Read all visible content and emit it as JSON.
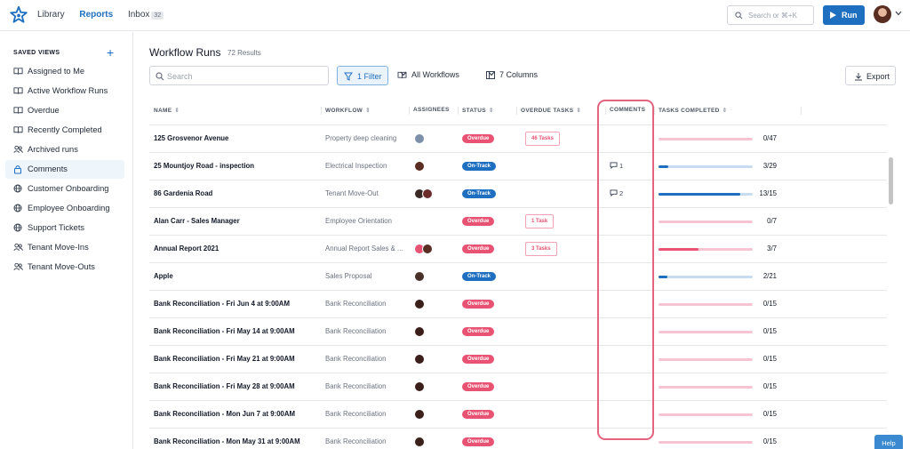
{
  "nav": {
    "library": "Library",
    "reports": "Reports",
    "inbox": "Inbox",
    "inbox_count": "32",
    "search_placeholder": "Search or ⌘+K",
    "run": "Run"
  },
  "sidebar": {
    "heading": "SAVED VIEWS",
    "items": [
      {
        "label": "Assigned to Me",
        "icon": "book-icon"
      },
      {
        "label": "Active Workflow Runs",
        "icon": "book-icon"
      },
      {
        "label": "Overdue",
        "icon": "book-icon"
      },
      {
        "label": "Recently Completed",
        "icon": "book-icon"
      },
      {
        "label": "Archived runs",
        "icon": "users-icon"
      },
      {
        "label": "Comments",
        "icon": "lock-icon"
      },
      {
        "label": "Customer Onboarding",
        "icon": "globe-icon"
      },
      {
        "label": "Employee Onboarding",
        "icon": "globe-icon"
      },
      {
        "label": "Support Tickets",
        "icon": "globe-icon"
      },
      {
        "label": "Tenant Move-Ins",
        "icon": "users-icon"
      },
      {
        "label": "Tenant Move-Outs",
        "icon": "users-icon"
      }
    ],
    "active_index": 5
  },
  "main": {
    "title": "Workflow Runs",
    "results": "72 Results",
    "search_placeholder": "Search",
    "filter": "1 Filter",
    "workflows": "All Workflows",
    "columns": "7 Columns",
    "export": "Export",
    "help": "Help"
  },
  "table": {
    "headers": [
      "NAME",
      "WORKFLOW",
      "ASSIGNEES",
      "STATUS",
      "OVERDUE TASKS",
      "COMMENTS",
      "TASKS COMPLETED"
    ],
    "rows": [
      {
        "name": "125 Grosvenor Avenue",
        "workflow": "Property deep cleaning",
        "assignees": [
          "#7b8fa6"
        ],
        "status": "Overdue",
        "overdue_tasks": "46 Tasks",
        "comments": "",
        "done": 0,
        "total": 47,
        "count": "0/47"
      },
      {
        "name": "25 Mountjoy Road - inspection",
        "workflow": "Electrical Inspection",
        "assignees": [
          "#5a2d22"
        ],
        "status": "On-Track",
        "overdue_tasks": "",
        "comments": "1",
        "done": 3,
        "total": 29,
        "count": "3/29"
      },
      {
        "name": "86 Gardenia Road",
        "workflow": "Tenant Move-Out",
        "assignees": [
          "#3a2a26",
          "#6b2b2b"
        ],
        "status": "On-Track",
        "overdue_tasks": "",
        "comments": "2",
        "done": 13,
        "total": 15,
        "count": "13/15"
      },
      {
        "name": "Alan Carr - Sales Manager",
        "workflow": "Employee Orientation",
        "assignees": [],
        "status": "Overdue",
        "overdue_tasks": "1 Task",
        "comments": "",
        "done": 0,
        "total": 7,
        "count": "0/7"
      },
      {
        "name": "Annual Report 2021",
        "workflow": "Annual Report Sales & ...",
        "assignees": [
          "#e95373",
          "#5a2d22"
        ],
        "status": "Overdue",
        "overdue_tasks": "3 Tasks",
        "comments": "",
        "done": 3,
        "total": 7,
        "count": "3/7"
      },
      {
        "name": "Apple",
        "workflow": "Sales Proposal",
        "assignees": [
          "#4a3028"
        ],
        "status": "On-Track",
        "overdue_tasks": "",
        "comments": "",
        "done": 2,
        "total": 21,
        "count": "2/21"
      },
      {
        "name": "Bank Reconciliation - Fri Jun 4 at 9:00AM",
        "workflow": "Bank Reconciliation",
        "assignees": [
          "#3b1f1a"
        ],
        "status": "Overdue",
        "overdue_tasks": "",
        "comments": "",
        "done": 0,
        "total": 15,
        "count": "0/15"
      },
      {
        "name": "Bank Reconciliation - Fri May 14 at 9:00AM",
        "workflow": "Bank Reconciliation",
        "assignees": [
          "#3b1f1a"
        ],
        "status": "Overdue",
        "overdue_tasks": "",
        "comments": "",
        "done": 0,
        "total": 15,
        "count": "0/15"
      },
      {
        "name": "Bank Reconciliation - Fri May 21 at 9:00AM",
        "workflow": "Bank Reconciliation",
        "assignees": [
          "#3b1f1a"
        ],
        "status": "Overdue",
        "overdue_tasks": "",
        "comments": "",
        "done": 0,
        "total": 15,
        "count": "0/15"
      },
      {
        "name": "Bank Reconciliation - Fri May 28 at 9:00AM",
        "workflow": "Bank Reconciliation",
        "assignees": [
          "#3b1f1a"
        ],
        "status": "Overdue",
        "overdue_tasks": "",
        "comments": "",
        "done": 0,
        "total": 15,
        "count": "0/15"
      },
      {
        "name": "Bank Reconciliation - Mon Jun 7 at 9:00AM",
        "workflow": "Bank Reconciliation",
        "assignees": [
          "#3b1f1a"
        ],
        "status": "Overdue",
        "overdue_tasks": "",
        "comments": "",
        "done": 0,
        "total": 15,
        "count": "0/15"
      },
      {
        "name": "Bank Reconciliation - Mon May 31 at 9:00AM",
        "workflow": "Bank Reconciliation",
        "assignees": [
          "#3b1f1a"
        ],
        "status": "Overdue",
        "overdue_tasks": "",
        "comments": "",
        "done": 0,
        "total": 15,
        "count": "0/15"
      }
    ]
  },
  "colors": {
    "accent": "#1e6fbf",
    "overdue": "#e95373",
    "track_overdue": "#f6c5d1",
    "track_ontrack": "#c7dcf0",
    "highlight": "#e4647f"
  }
}
